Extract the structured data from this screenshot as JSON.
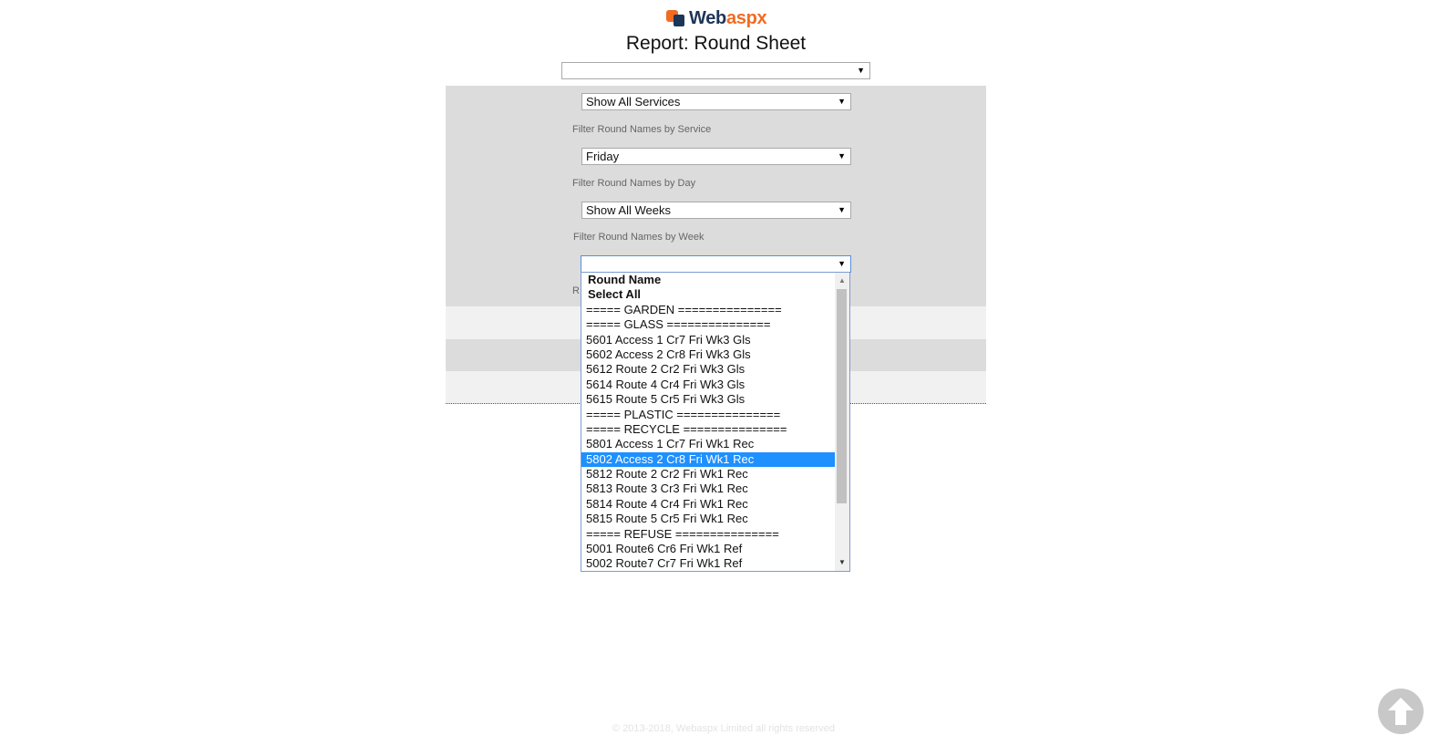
{
  "brand": {
    "name_part1": "Web",
    "name_part2": "aspx",
    "orange": "#f26b21",
    "navy": "#1d3557"
  },
  "page": {
    "title": "Report: Round Sheet"
  },
  "top_select": {
    "value": ""
  },
  "filters": {
    "service": {
      "value": "Show All Services",
      "caption": "Filter Round Names by Service"
    },
    "day": {
      "value": "Friday",
      "caption": "Filter Round Names by Day"
    },
    "week": {
      "value": "Show All Weeks",
      "caption": "Filter Round Names by Week"
    },
    "round": {
      "value": "",
      "caption_partial": "R"
    }
  },
  "round_dropdown": {
    "options": [
      {
        "label": "Round Name",
        "kind": "group"
      },
      {
        "label": "Select All",
        "kind": "group"
      },
      {
        "label": "===== GARDEN ===============",
        "kind": "option"
      },
      {
        "label": "===== GLASS ===============",
        "kind": "option"
      },
      {
        "label": "5601 Access 1 Cr7 Fri Wk3 Gls",
        "kind": "option"
      },
      {
        "label": "5602 Access 2 Cr8 Fri Wk3 Gls",
        "kind": "option"
      },
      {
        "label": "5612 Route 2 Cr2 Fri Wk3 Gls",
        "kind": "option"
      },
      {
        "label": "5614 Route 4 Cr4 Fri Wk3 Gls",
        "kind": "option"
      },
      {
        "label": "5615 Route 5 Cr5 Fri Wk3 Gls",
        "kind": "option"
      },
      {
        "label": "===== PLASTIC ===============",
        "kind": "option"
      },
      {
        "label": "===== RECYCLE ===============",
        "kind": "option"
      },
      {
        "label": "5801 Access 1 Cr7 Fri Wk1 Rec",
        "kind": "option"
      },
      {
        "label": "5802 Access 2 Cr8 Fri Wk1 Rec",
        "kind": "option",
        "selected": true
      },
      {
        "label": "5812 Route 2 Cr2 Fri Wk1 Rec",
        "kind": "option"
      },
      {
        "label": "5813 Route 3 Cr3 Fri Wk1 Rec",
        "kind": "option"
      },
      {
        "label": "5814 Route 4 Cr4 Fri Wk1 Rec",
        "kind": "option"
      },
      {
        "label": "5815 Route 5 Cr5 Fri Wk1 Rec",
        "kind": "option"
      },
      {
        "label": "===== REFUSE ===============",
        "kind": "option"
      },
      {
        "label": "5001 Route6 Cr6 Fri Wk1 Ref",
        "kind": "option"
      },
      {
        "label": "5002 Route7 Cr7 Fri Wk1 Ref",
        "kind": "option"
      }
    ],
    "highlight_color": "#1e90ff"
  },
  "footer": {
    "text": "© 2013-2018, Webaspx Limited all rights reserved"
  },
  "icons": {
    "dropdown_arrow": "▼",
    "scroll_up": "▲",
    "scroll_down": "▼",
    "scroll_to_top": "arrow-up-icon"
  }
}
